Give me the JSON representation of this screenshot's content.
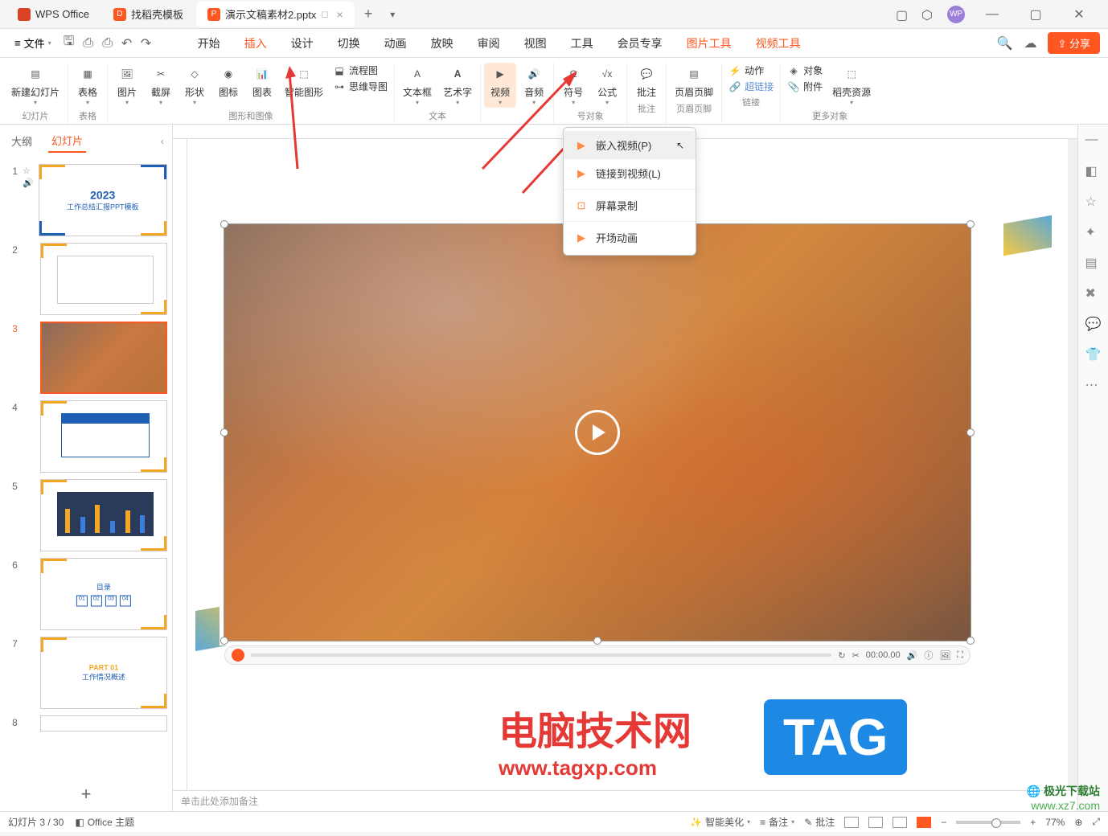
{
  "titlebar": {
    "tabs": [
      {
        "label": "WPS Office"
      },
      {
        "label": "找稻壳模板"
      },
      {
        "label": "演示文稿素材2.pptx"
      }
    ],
    "user_badge": "WP"
  },
  "menubar": {
    "file": "文件",
    "tabs": [
      "开始",
      "插入",
      "设计",
      "切换",
      "动画",
      "放映",
      "审阅",
      "视图",
      "工具",
      "会员专享",
      "图片工具",
      "视频工具"
    ],
    "active_tab": "插入",
    "share": "分享"
  },
  "ribbon": {
    "groups": [
      {
        "label": "幻灯片",
        "items": [
          {
            "label": "新建幻灯片"
          }
        ]
      },
      {
        "label": "表格",
        "items": [
          {
            "label": "表格"
          }
        ]
      },
      {
        "label": "图形和图像",
        "items": [
          {
            "label": "图片"
          },
          {
            "label": "截屏"
          },
          {
            "label": "形状"
          },
          {
            "label": "图标"
          },
          {
            "label": "图表"
          },
          {
            "label": "智能图形"
          },
          {
            "label": "流程图"
          },
          {
            "label": "思维导图"
          }
        ]
      },
      {
        "label": "文本",
        "items": [
          {
            "label": "文本框"
          },
          {
            "label": "艺术字"
          }
        ]
      },
      {
        "label": "",
        "items": [
          {
            "label": "视频"
          },
          {
            "label": "音频"
          }
        ]
      },
      {
        "label": "号对象",
        "items": [
          {
            "label": "符号"
          },
          {
            "label": "公式"
          }
        ]
      },
      {
        "label": "批注",
        "items": [
          {
            "label": "批注"
          }
        ]
      },
      {
        "label": "页眉页脚",
        "items": [
          {
            "label": "页眉页脚"
          }
        ]
      },
      {
        "label": "链接",
        "items": [
          {
            "label": "动作"
          },
          {
            "label": "超链接"
          }
        ]
      },
      {
        "label": "更多对象",
        "items": [
          {
            "label": "对象"
          },
          {
            "label": "附件"
          },
          {
            "label": "稻壳资源"
          }
        ]
      }
    ]
  },
  "dropdown": {
    "items": [
      {
        "label": "嵌入视频(P)",
        "hover": true
      },
      {
        "label": "链接到视频(L)"
      },
      {
        "label": "屏幕录制"
      },
      {
        "label": "开场动画"
      }
    ]
  },
  "slide_panel": {
    "tabs": [
      "大纲",
      "幻灯片"
    ],
    "active_tab": "幻灯片",
    "slides": [
      {
        "n": 1,
        "title": "2023",
        "sub": "工作总结汇报PPT模板"
      },
      {
        "n": 2,
        "title": ""
      },
      {
        "n": 3,
        "title": "",
        "selected": true
      },
      {
        "n": 4,
        "title": ""
      },
      {
        "n": 5,
        "title": ""
      },
      {
        "n": 6,
        "title": "目录"
      },
      {
        "n": 7,
        "title": "PART 01",
        "sub": "工作情况概述"
      },
      {
        "n": 8,
        "title": ""
      }
    ]
  },
  "video": {
    "timecode": "00:00.00"
  },
  "notes": {
    "placeholder": "单击此处添加备注"
  },
  "statusbar": {
    "slide_info": "幻灯片 3 / 30",
    "theme": "Office 主题",
    "beautify": "智能美化",
    "notes": "备注",
    "annotate": "批注",
    "zoom": "77%"
  },
  "watermark": {
    "title": "电脑技术网",
    "url": "www.tagxp.com",
    "tag": "TAG",
    "site2": "极光下载站",
    "site2_url": "www.xz7.com"
  }
}
